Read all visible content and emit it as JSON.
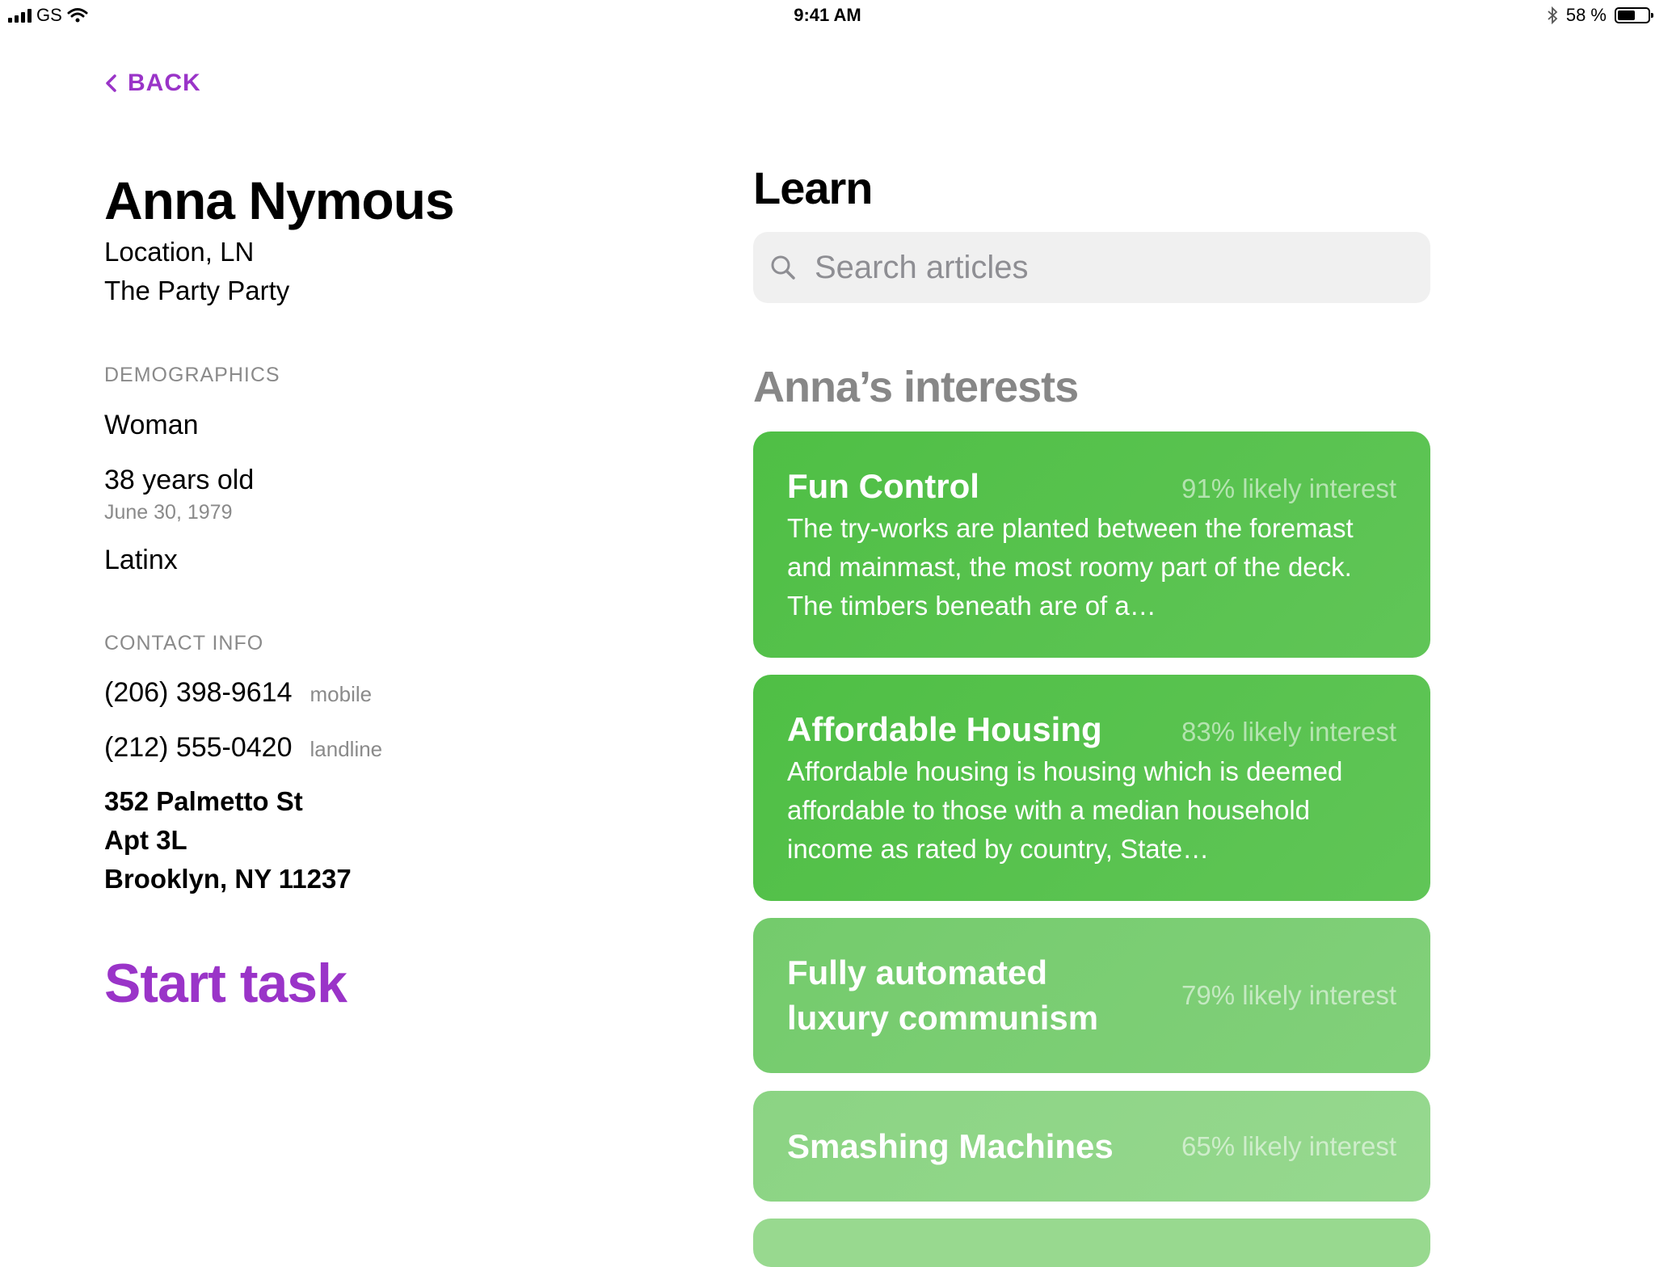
{
  "status": {
    "carrier": "GS",
    "time": "9:41 AM",
    "battery_text": "58 %",
    "battery_level": 0.58
  },
  "nav": {
    "back_label": "BACK"
  },
  "profile": {
    "name": "Anna Nymous",
    "location": "Location, LN",
    "party": "The Party Party",
    "demographics_header": "DEMOGRAPHICS",
    "gender": "Woman",
    "age": "38 years old",
    "birthdate": "June 30, 1979",
    "ethnicity": "Latinx",
    "contact_header": "CONTACT INFO",
    "phones": [
      {
        "number": "(206) 398-9614",
        "type": "mobile"
      },
      {
        "number": "(212) 555-0420",
        "type": "landline"
      }
    ],
    "address": {
      "line1": "352 Palmetto St",
      "line2": "Apt 3L",
      "line3": "Brooklyn, NY 11237"
    },
    "start_label": "Start task"
  },
  "learn": {
    "title": "Learn",
    "search_placeholder": "Search articles",
    "interests_title": "Anna’s interests",
    "cards": [
      {
        "title": "Fun Control",
        "likelihood": "91% likely interest",
        "summary": "The try-works are planted between the foremast and mainmast, the most roomy part of the deck. The timbers beneath are of a…",
        "color": "#4fbf45"
      },
      {
        "title": "Affordable Housing",
        "likelihood": "83% likely interest",
        "summary": "Affordable housing is housing which is deemed affordable to those with a median household income as rated by country, State…",
        "color": "#4fbf45"
      },
      {
        "title": "Fully automated luxury communism",
        "likelihood": "79% likely interest",
        "color": "#74cb6c"
      },
      {
        "title": "Smashing Machines",
        "likelihood": "65% likely interest",
        "color": "#8bd483"
      }
    ]
  },
  "colors": {
    "accent": "#9a34c8",
    "muted": "#8a8a8a"
  }
}
